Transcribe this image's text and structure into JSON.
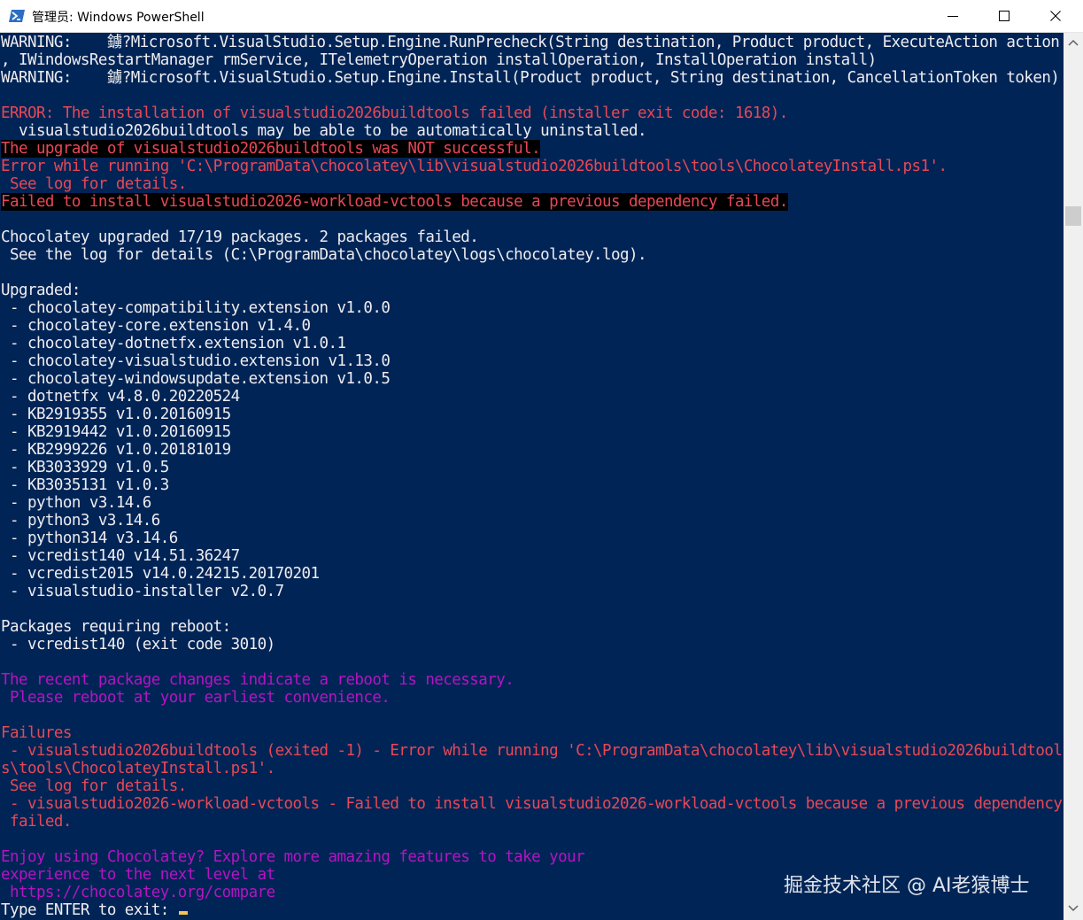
{
  "window": {
    "title": "管理员: Windows PowerShell"
  },
  "icons": {
    "app": "powershell-icon",
    "minimize": "minimize-icon",
    "maximize": "maximize-icon",
    "close": "close-icon"
  },
  "colors": {
    "console_bg": "#012456",
    "default_fg": "#eeedf0",
    "error_fg": "#e74856",
    "highlight_fg": "#b414c2",
    "cursor": "#f6c54f"
  },
  "console": {
    "lines": [
      {
        "text": "WARNING:    鐪?Microsoft.VisualStudio.Setup.Engine.RunPrecheck(String destination, Product product, ExecuteAction action",
        "style": "normal"
      },
      {
        "text": ", IWindowsRestartManager rmService, ITelemetryOperation installOperation, InstallOperation install)",
        "style": "normal"
      },
      {
        "text": "WARNING:    鐪?Microsoft.VisualStudio.Setup.Engine.Install(Product product, String destination, CancellationToken token)",
        "style": "normal"
      },
      {
        "text": "",
        "style": "normal"
      },
      {
        "text": "ERROR: The installation of visualstudio2026buildtools failed (installer exit code: 1618).",
        "style": "error"
      },
      {
        "text": "  visualstudio2026buildtools may be able to be automatically uninstalled.",
        "style": "normal"
      },
      {
        "text": "The upgrade of visualstudio2026buildtools was NOT successful.",
        "style": "error-black"
      },
      {
        "text": "Error while running 'C:\\ProgramData\\chocolatey\\lib\\visualstudio2026buildtools\\tools\\ChocolateyInstall.ps1'.",
        "style": "error"
      },
      {
        "text": " See log for details.",
        "style": "error"
      },
      {
        "text": "Failed to install visualstudio2026-workload-vctools because a previous dependency failed.",
        "style": "error-black"
      },
      {
        "text": "",
        "style": "normal"
      },
      {
        "text": "Chocolatey upgraded 17/19 packages. 2 packages failed.",
        "style": "normal"
      },
      {
        "text": " See the log for details (C:\\ProgramData\\chocolatey\\logs\\chocolatey.log).",
        "style": "normal"
      },
      {
        "text": "",
        "style": "normal"
      },
      {
        "text": "Upgraded:",
        "style": "normal"
      },
      {
        "text": " - chocolatey-compatibility.extension v1.0.0",
        "style": "normal"
      },
      {
        "text": " - chocolatey-core.extension v1.4.0",
        "style": "normal"
      },
      {
        "text": " - chocolatey-dotnetfx.extension v1.0.1",
        "style": "normal"
      },
      {
        "text": " - chocolatey-visualstudio.extension v1.13.0",
        "style": "normal"
      },
      {
        "text": " - chocolatey-windowsupdate.extension v1.0.5",
        "style": "normal"
      },
      {
        "text": " - dotnetfx v4.8.0.20220524",
        "style": "normal"
      },
      {
        "text": " - KB2919355 v1.0.20160915",
        "style": "normal"
      },
      {
        "text": " - KB2919442 v1.0.20160915",
        "style": "normal"
      },
      {
        "text": " - KB2999226 v1.0.20181019",
        "style": "normal"
      },
      {
        "text": " - KB3033929 v1.0.5",
        "style": "normal"
      },
      {
        "text": " - KB3035131 v1.0.3",
        "style": "normal"
      },
      {
        "text": " - python v3.14.6",
        "style": "normal"
      },
      {
        "text": " - python3 v3.14.6",
        "style": "normal"
      },
      {
        "text": " - python314 v3.14.6",
        "style": "normal"
      },
      {
        "text": " - vcredist140 v14.51.36247",
        "style": "normal"
      },
      {
        "text": " - vcredist2015 v14.0.24215.20170201",
        "style": "normal"
      },
      {
        "text": " - visualstudio-installer v2.0.7",
        "style": "normal"
      },
      {
        "text": "",
        "style": "normal"
      },
      {
        "text": "Packages requiring reboot:",
        "style": "normal"
      },
      {
        "text": " - vcredist140 (exit code 3010)",
        "style": "normal"
      },
      {
        "text": "",
        "style": "normal"
      },
      {
        "text": "The recent package changes indicate a reboot is necessary.",
        "style": "highlight"
      },
      {
        "text": " Please reboot at your earliest convenience.",
        "style": "highlight"
      },
      {
        "text": "",
        "style": "normal"
      },
      {
        "text": "Failures",
        "style": "error"
      },
      {
        "text": " - visualstudio2026buildtools (exited -1) - Error while running 'C:\\ProgramData\\chocolatey\\lib\\visualstudio2026buildtool",
        "style": "error"
      },
      {
        "text": "s\\tools\\ChocolateyInstall.ps1'.",
        "style": "error"
      },
      {
        "text": " See log for details.",
        "style": "error"
      },
      {
        "text": " - visualstudio2026-workload-vctools - Failed to install visualstudio2026-workload-vctools because a previous dependency",
        "style": "error"
      },
      {
        "text": " failed.",
        "style": "error"
      },
      {
        "text": "",
        "style": "normal"
      },
      {
        "text": "Enjoy using Chocolatey? Explore more amazing features to take your",
        "style": "highlight"
      },
      {
        "text": "experience to the next level at",
        "style": "highlight"
      },
      {
        "text": " https://chocolatey.org/compare",
        "style": "highlight"
      },
      {
        "text": "Type ENTER to exit: ",
        "style": "prompt"
      }
    ]
  },
  "watermark": {
    "text": "掘金技术社区 @ AI老猿博士"
  }
}
